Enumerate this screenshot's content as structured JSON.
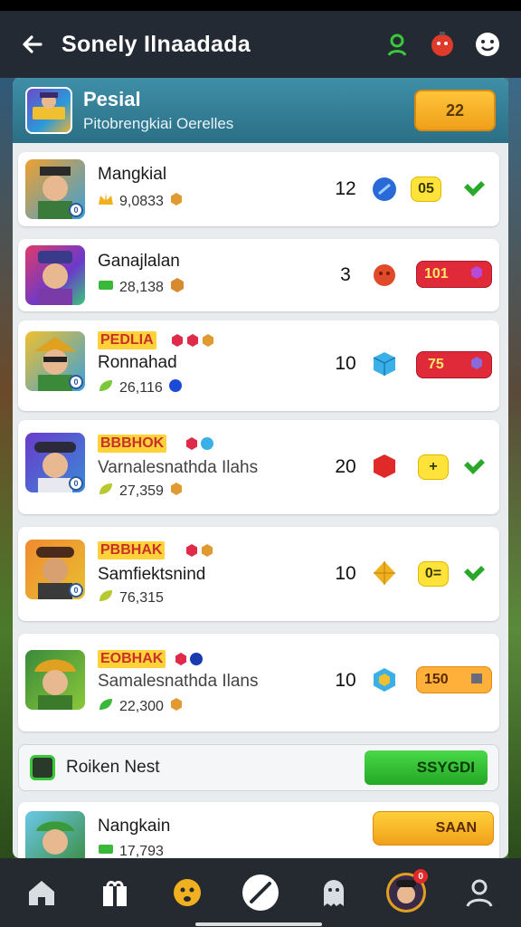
{
  "topbar": {
    "title": "Sonely Ilnaadada",
    "icons": [
      "back-arrow-icon",
      "green-person-icon",
      "red-bomb-icon",
      "smiley-icon"
    ]
  },
  "header": {
    "title": "Pesial",
    "subtitle": "Pitobrengkiai Oerelles",
    "button_label": "22"
  },
  "rows": [
    {
      "tag": "",
      "name": "Mangkial",
      "score": "9,0833",
      "number": "12",
      "gem": "blue-orb",
      "pill_text": "05",
      "pill_color": "yellow",
      "action": "check",
      "badge": "0"
    },
    {
      "tag": "",
      "name": "Ganajlalan",
      "score": "28,138",
      "number": "3",
      "gem": "red-orb",
      "pill_text": "101",
      "pill_color": "red",
      "action": "purple-gem",
      "badge": ""
    },
    {
      "tag": "PEDLIA",
      "name": "Ronnahad",
      "score": "26,116",
      "number": "10",
      "gem": "blue-cube",
      "pill_text": "75",
      "pill_color": "red",
      "action": "purple-gem",
      "badge": "0"
    },
    {
      "tag": "BBBHOK",
      "name": "Varnalesnathda Ilahs",
      "score": "27,359",
      "number": "20",
      "gem": "red-cube",
      "pill_text": "+",
      "pill_color": "yellow",
      "action": "check",
      "badge": "0"
    },
    {
      "tag": "PBBHAK",
      "name": "Samfiektsnind",
      "score": "76,315",
      "number": "10",
      "gem": "gold-diamond",
      "pill_text": "0=",
      "pill_color": "yellow",
      "action": "check",
      "badge": "0"
    },
    {
      "tag": "EOBHAK",
      "name": "Samalesnathda Ilans",
      "score": "22,300",
      "number": "10",
      "gem": "blue-hexagon",
      "pill_text": "150",
      "pill_color": "orange",
      "action": "box",
      "badge": ""
    }
  ],
  "broken_nest": {
    "label": "Roiken Nest",
    "button": "SSYGDI"
  },
  "last_row": {
    "name": "Nangkain",
    "score": "17,793",
    "button": "SAAN"
  },
  "bottomnav": {
    "items": [
      "home-icon",
      "gift-icon",
      "emoji-icon",
      "pencil-icon",
      "ghost-icon",
      "profile-avatar-icon",
      "user-icon"
    ],
    "badge": "0"
  },
  "colors": {
    "topbar": "#232a33",
    "header": "#2b6f85",
    "green_check": "#2aa82a",
    "gold": "#f0a01a"
  }
}
